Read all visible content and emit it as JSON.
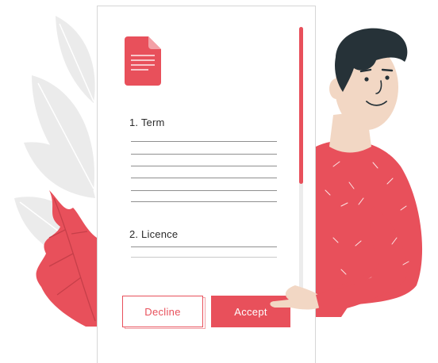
{
  "document": {
    "icon": "document-icon",
    "sections": [
      {
        "title": "1. Term"
      },
      {
        "title": "2. Licence"
      }
    ]
  },
  "actions": {
    "decline_label": "Decline",
    "accept_label": "Accept"
  },
  "colors": {
    "accent": "#e8505b",
    "skin": "#f2d7c4",
    "hair": "#263238",
    "leaf_gray": "#e6e6e6"
  }
}
